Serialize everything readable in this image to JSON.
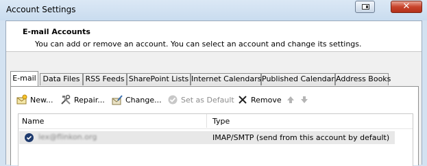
{
  "window": {
    "title": "Account Settings",
    "help_icon": "help-icon",
    "close_icon": "close-icon"
  },
  "header": {
    "title": "E-mail Accounts",
    "description": "You can add or remove an account. You can select an account and change its settings."
  },
  "tabs": [
    {
      "label": "E-mail",
      "active": true
    },
    {
      "label": "Data Files",
      "active": false
    },
    {
      "label": "RSS Feeds",
      "active": false
    },
    {
      "label": "SharePoint Lists",
      "active": false
    },
    {
      "label": "Internet Calendars",
      "active": false
    },
    {
      "label": "Published Calendars",
      "active": false
    },
    {
      "label": "Address Books",
      "active": false
    }
  ],
  "toolbar": {
    "new_label": "New...",
    "repair_label": "Repair...",
    "change_label": "Change...",
    "set_default_label": "Set as Default",
    "remove_label": "Remove"
  },
  "list": {
    "columns": {
      "name": "Name",
      "type": "Type"
    },
    "rows": [
      {
        "name": "lex@flinkon.org",
        "type": "IMAP/SMTP (send from this account by default)",
        "is_default": true
      }
    ]
  },
  "colors": {
    "title_bar": "#c9dcef",
    "close_button": "#c8442c",
    "selected_row": "#e8e8e8",
    "default_marker": "#1f3b6e"
  }
}
